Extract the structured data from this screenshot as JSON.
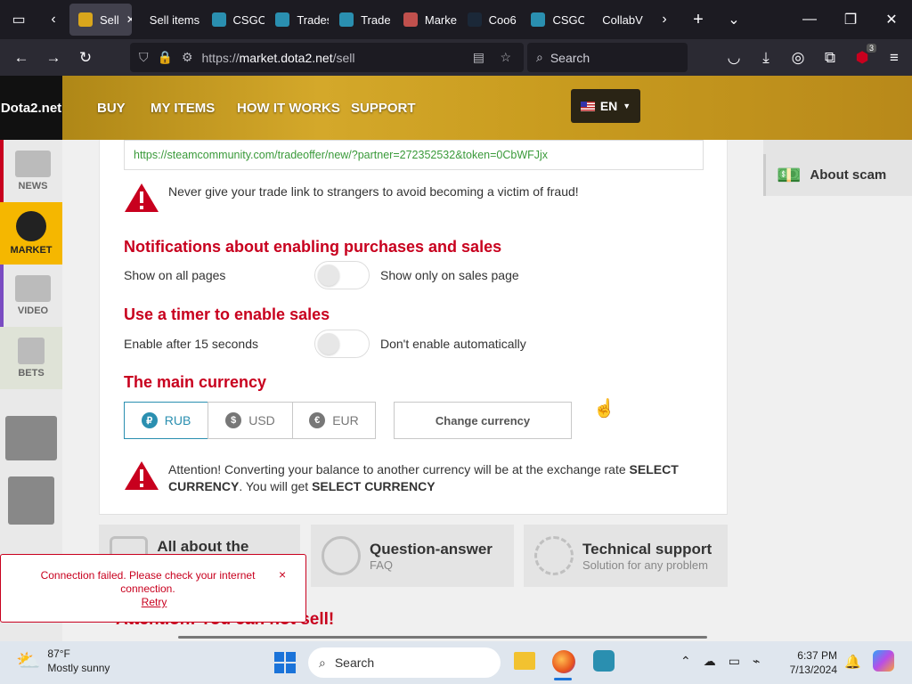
{
  "browser": {
    "tabs": [
      {
        "label": "Sell",
        "active": true,
        "favicon_color": "#d9a61c"
      },
      {
        "label": "Sell items",
        "active": false,
        "favicon_color": ""
      },
      {
        "label": "CSGO",
        "active": false,
        "favicon_color": "#2a8fb0"
      },
      {
        "label": "Trades",
        "active": false,
        "favicon_color": "#2a8fb0"
      },
      {
        "label": "Trade",
        "active": false,
        "favicon_color": "#2a8fb0"
      },
      {
        "label": "Marke",
        "active": false,
        "favicon_color": "#c0504d"
      },
      {
        "label": "Coo6",
        "active": false,
        "favicon_color": "#1b2838"
      },
      {
        "label": "CSGO",
        "active": false,
        "favicon_color": "#2a8fb0"
      },
      {
        "label": "CollabV",
        "active": false,
        "favicon_color": ""
      }
    ],
    "url": "https://market.dota2.net/sell",
    "url_host": "market.dota2.net",
    "url_prefix": "https://",
    "url_path": "/sell",
    "search_placeholder": "Search",
    "extension_badge": "3"
  },
  "site": {
    "logo": "Dota2.net",
    "nav": [
      "BUY",
      "MY ITEMS",
      "HOW IT WORKS",
      "SUPPORT"
    ],
    "lang": "EN",
    "leftnav": [
      {
        "label": "NEWS",
        "icon": "newspaper-icon"
      },
      {
        "label": "MARKET",
        "icon": "market-icon",
        "active": true
      },
      {
        "label": "VIDEO",
        "icon": "film-icon"
      },
      {
        "label": "BETS",
        "icon": "dice-icon"
      },
      {
        "label": "",
        "icon": "csgo-game-icon"
      },
      {
        "label": "",
        "icon": "rust-game-icon"
      }
    ],
    "aside_item": "About scam"
  },
  "settings": {
    "trade_link": "https://steamcommunity.com/tradeoffer/new/?partner=272352532&token=0CbWFJjx",
    "trade_warning": "Never give your trade link to strangers to avoid becoming a victim of fraud!",
    "notif_heading": "Notifications about enabling purchases and sales",
    "notif_left": "Show on all pages",
    "notif_right": "Show only on sales page",
    "timer_heading": "Use a timer to enable sales",
    "timer_left": "Enable after 15 seconds",
    "timer_right": "Don't enable automatically",
    "currency_heading": "The main currency",
    "currencies": [
      {
        "code": "RUB",
        "symbol": "₽",
        "selected": true
      },
      {
        "code": "USD",
        "symbol": "$",
        "selected": false
      },
      {
        "code": "EUR",
        "symbol": "€",
        "selected": false
      }
    ],
    "change_currency": "Change currency",
    "convert_warning_a": "Attention! Converting your balance to another currency will be at the exchange rate ",
    "convert_warning_b": "SELECT CURRENCY",
    "convert_warning_c": ". You will get ",
    "convert_warning_d": "SELECT CURRENCY"
  },
  "info_cards": [
    {
      "title": "All about the market",
      "subtitle": ""
    },
    {
      "title": "Question-answer",
      "subtitle": "FAQ"
    },
    {
      "title": "Technical support",
      "subtitle": "Solution for any problem"
    }
  ],
  "bottom_notice": "Attention! You can not sell!",
  "toast": {
    "message": "Connection failed. Please check your internet connection.",
    "retry": "Retry",
    "close": "×"
  },
  "taskbar": {
    "weather_temp": "87°F",
    "weather_desc": "Mostly sunny",
    "search": "Search",
    "time": "6:37 PM",
    "date": "7/13/2024"
  }
}
